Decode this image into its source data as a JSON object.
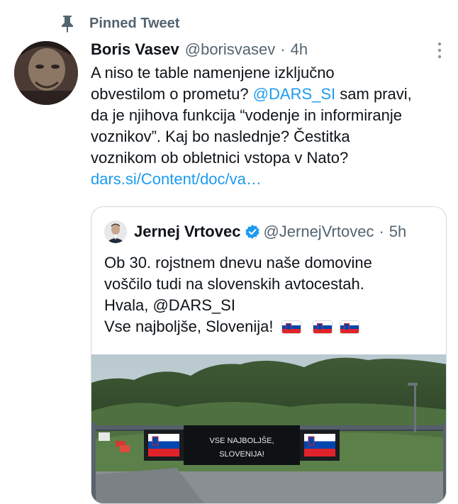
{
  "pinned": {
    "label": "Pinned Tweet"
  },
  "tweet": {
    "name": "Boris Vasev",
    "handle": "@borisvasev",
    "dot": "·",
    "time": "4h",
    "lines": [
      [
        "A niso te table namenjene izključno"
      ],
      [
        "obvestilom o prometu? ",
        "@DARS_SI",
        " sam pravi,"
      ],
      [
        "da je njihova funkcija “vodenje in informiranje"
      ],
      [
        "voznikov”. Kaj bo naslednje? Čestitka"
      ],
      [
        "voznikom ob obletnici vstopa v Nato?"
      ]
    ],
    "mention": "@DARS_SI",
    "link": "dars.si/Content/doc/va…"
  },
  "quote": {
    "name": "Jernej Vrtovec",
    "handle": "@JernejVrtovec",
    "dot": "·",
    "time": "5h",
    "line1": "Ob 30. rojstnem dnevu naše domovine",
    "line2": "voščilo tudi na slovenskih avtocestah.",
    "line3": "Hvala, @DARS_SI",
    "line4": "Vse najboljše, Slovenija!",
    "flags_count": 3,
    "sign_line1": "VSE NAJBOLJŠE,",
    "sign_line2": "SLOVENIJA!"
  },
  "colors": {
    "link": "#1d9bf0",
    "secondary": "#536471",
    "verified": "#1d9bf0",
    "flag_blue": "#0046ae",
    "flag_red": "#e0232b"
  },
  "icons": [
    "pin-icon",
    "more-icon",
    "verified-icon"
  ]
}
